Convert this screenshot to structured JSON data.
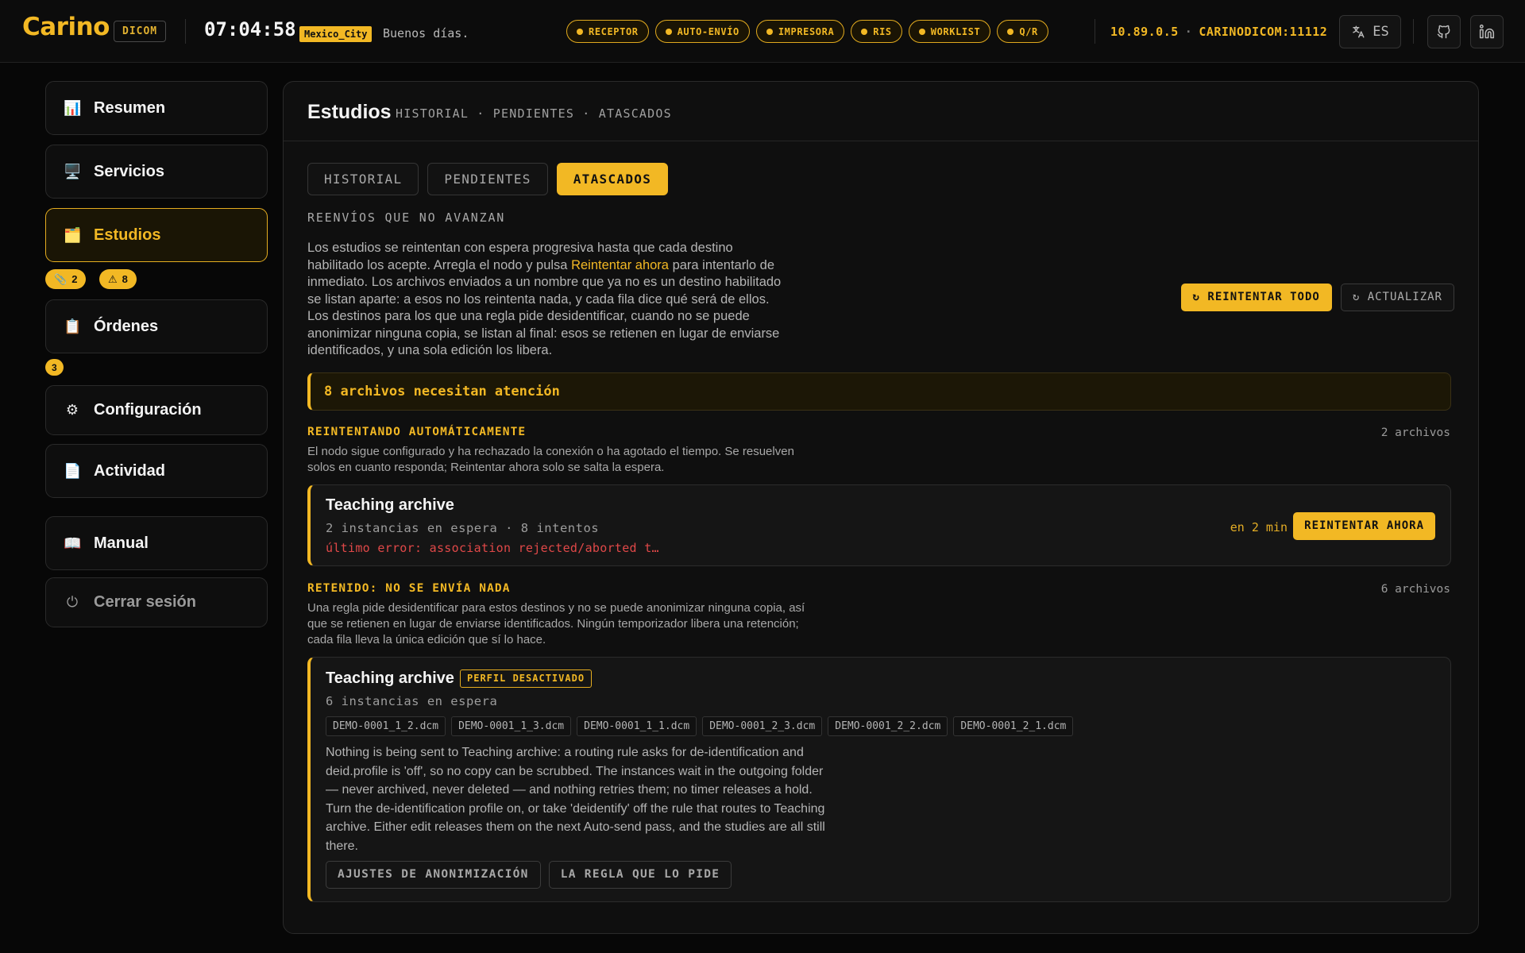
{
  "header": {
    "logo": "Carino",
    "product_tag": "DICOM",
    "clock": "07:04:58",
    "timezone": "Mexico_City",
    "greeting": "Buenos días.",
    "services": [
      {
        "label": "RECEPTOR",
        "icon": "status-dot-icon"
      },
      {
        "label": "AUTO-ENVÍO",
        "icon": "status-dot-icon"
      },
      {
        "label": "IMPRESORA",
        "icon": "status-dot-icon"
      },
      {
        "label": "RIS",
        "icon": "status-dot-icon"
      },
      {
        "label": "WORKLIST",
        "icon": "status-dot-icon"
      },
      {
        "label": "Q/R",
        "icon": "status-dot-icon"
      }
    ],
    "ip": "10.89.0.5",
    "separator": "·",
    "ae_title": "CARINODICOM:11112",
    "language": "ES",
    "accent_color": "#f2b824"
  },
  "sidebar": {
    "items": [
      {
        "label": "Resumen",
        "icon": "bar-chart-icon",
        "glyph": "📊"
      },
      {
        "label": "Servicios",
        "icon": "monitor-icon",
        "glyph": "🖥️"
      },
      {
        "label": "Estudios",
        "icon": "folder-icon",
        "glyph": "🗂️"
      },
      {
        "label": "Órdenes",
        "icon": "clipboard-icon",
        "glyph": "📋"
      },
      {
        "label": "Configuración",
        "icon": "gear-icon",
        "glyph": "⚙"
      },
      {
        "label": "Actividad",
        "icon": "document-icon",
        "glyph": "📄"
      },
      {
        "label": "Manual",
        "icon": "book-icon",
        "glyph": "📖"
      },
      {
        "label": "Cerrar sesión",
        "icon": "power-icon",
        "glyph": "⏻"
      }
    ],
    "estudios_badges": [
      {
        "icon": "paperclip-icon",
        "glyph": "📎",
        "count": "2"
      },
      {
        "icon": "warning-icon",
        "glyph": "⚠",
        "count": "8"
      }
    ],
    "ordenes_badge": "3"
  },
  "main": {
    "title": "Estudios",
    "subtitle": "HISTORIAL · PENDIENTES · ATASCADOS",
    "tabs": [
      "HISTORIAL",
      "PENDIENTES",
      "ATASCADOS"
    ],
    "active_tab": "ATASCADOS",
    "eyebrow": "REENVÍOS QUE NO AVANZAN",
    "intro_before": "Los estudios se reintentan con espera progresiva hasta que cada destino habilitado los acepte. Arregla el nodo y pulsa ",
    "intro_highlight": "Reintentar ahora",
    "intro_after": " para intentarlo de inmediato. Los archivos enviados a un nombre que ya no es un destino habilitado se listan aparte: a esos no los reintenta nada, y cada fila dice qué será de ellos. Los destinos para los que una regla pide desidentificar, cuando no se puede anonimizar ninguna copia, se listan al final: esos se retienen en lugar de enviarse identificados, y una sola edición los libera.",
    "retry_all": "↻ REINTENTAR TODO",
    "refresh": "↻ ACTUALIZAR",
    "alert": "8 archivos necesitan atención",
    "groups": {
      "retrying": {
        "heading": "REINTENTANDO AUTOMÁTICAMENTE",
        "count": "2 archivos",
        "description": "El nodo sigue configurado y ha rechazado la conexión o ha agotado el tiempo. Se resuelven solos en cuanto responda; Reintentar ahora solo se salta la espera.",
        "card": {
          "title": "Teaching archive",
          "meta": "2 instancias en espera · 8 intentos",
          "error": "último error: association rejected/aborted t…",
          "eta": "en 2 min",
          "retry_now": "REINTENTAR AHORA"
        }
      },
      "held": {
        "heading": "RETENIDO: NO SE ENVÍA NADA",
        "count": "6 archivos",
        "description": "Una regla pide desidentificar para estos destinos y no se puede anonimizar ninguna copia, así que se retienen en lugar de enviarse identificados. Ningún temporizador libera una retención; cada fila lleva la única edición que sí lo hace.",
        "card": {
          "title": "Teaching archive",
          "badge": "PERFIL DESACTIVADO",
          "meta": "6 instancias en espera",
          "files": [
            "DEMO-0001_1_2.dcm",
            "DEMO-0001_1_3.dcm",
            "DEMO-0001_1_1.dcm",
            "DEMO-0001_2_3.dcm",
            "DEMO-0001_2_2.dcm",
            "DEMO-0001_2_1.dcm"
          ],
          "explanation": "Nothing is being sent to Teaching archive: a routing rule asks for de-identification and deid.profile is 'off', so no copy can be scrubbed. The instances wait in the outgoing folder — never archived, never deleted — and nothing retries them; no timer releases a hold. Turn the de-identification profile on, or take 'deidentify' off the rule that routes to Teaching archive. Either edit releases them on the next Auto-send pass, and the studies are all still there.",
          "btn_settings": "AJUSTES DE ANONIMIZACIÓN",
          "btn_rule": "LA REGLA QUE LO PIDE"
        }
      }
    }
  }
}
